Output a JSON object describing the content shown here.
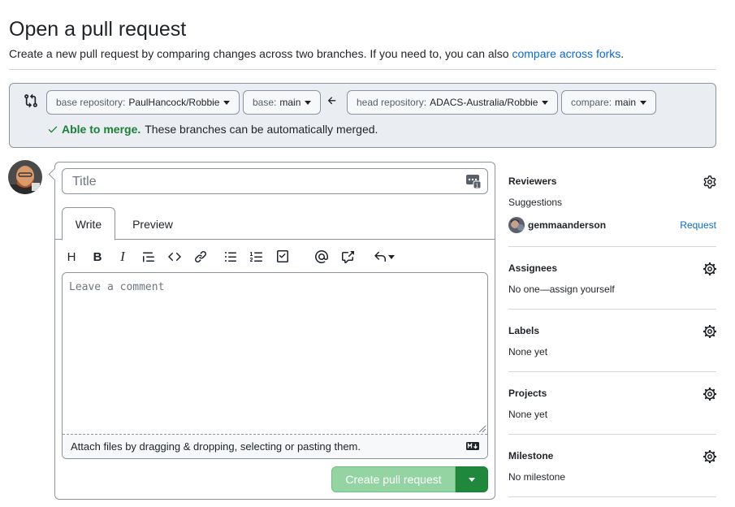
{
  "page": {
    "title": "Open a pull request",
    "subtitle_prefix": "Create a new pull request by comparing changes across two branches. If you need to, you can also ",
    "subtitle_link": "compare across forks",
    "subtitle_suffix": "."
  },
  "range": {
    "base_repo_label": "base repository:",
    "base_repo_value": "PaulHancock/Robbie",
    "base_label": "base:",
    "base_value": "main",
    "head_repo_label": "head repository:",
    "head_repo_value": "ADACS-Australia/Robbie",
    "compare_label": "compare:",
    "compare_value": "main",
    "merge_status_strong": "Able to merge.",
    "merge_status_text": "These branches can be automatically merged."
  },
  "form": {
    "title_placeholder": "Title",
    "tabs": [
      {
        "label": "Write"
      },
      {
        "label": "Preview"
      }
    ],
    "toolbar": {
      "heading": "H",
      "bold": "B",
      "italic": "I"
    },
    "comment_placeholder": "Leave a comment",
    "attach_text": "Attach files by dragging & dropping, selecting or pasting them.",
    "create_button": "Create pull request"
  },
  "sidebar": {
    "reviewers": {
      "heading": "Reviewers",
      "suggestions_label": "Suggestions",
      "suggested_user": "gemmaanderson",
      "request_link": "Request"
    },
    "assignees": {
      "heading": "Assignees",
      "text": "No one—assign yourself"
    },
    "labels": {
      "heading": "Labels",
      "text": "None yet"
    },
    "projects": {
      "heading": "Projects",
      "text": "None yet"
    },
    "milestone": {
      "heading": "Milestone",
      "text": "No milestone"
    }
  },
  "colors": {
    "link": "#0969da",
    "success": "#1a7f37",
    "primary_button": "#1f883d",
    "primary_button_disabled": "#94d3a2",
    "border": "#8c959f",
    "muted_bg": "#eaeef2"
  }
}
